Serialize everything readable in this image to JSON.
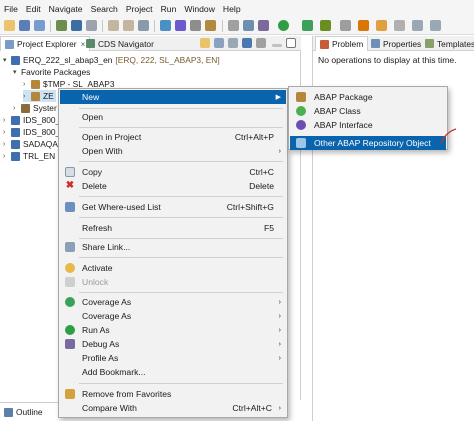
{
  "menubar": [
    "File",
    "Edit",
    "Navigate",
    "Search",
    "Project",
    "Run",
    "Window",
    "Help"
  ],
  "left_tabs": {
    "project_explorer": "Project Explorer",
    "cds_navigator": "CDS Navigator"
  },
  "tree": {
    "root_name": "ERQ_222_sl_abap3_en",
    "root_decor": "[ERQ, 222, SL_ABAP3, EN]",
    "favorite_packages": "Favorite Packages",
    "tmp_package": "$TMP - SL_ABAP3",
    "ze_item": "ZE",
    "system_item": "Syster",
    "ids1": "IDS_800_",
    "ids2": "IDS_800_",
    "sadaq": "SADAQA",
    "trl": "TRL_EN ["
  },
  "right_tabs": {
    "problems": "Problem",
    "properties": "Properties",
    "templates": "Templates"
  },
  "right_message": "No operations to display at this time.",
  "outline_tab": "Outline",
  "context_menu": {
    "new": "New",
    "open": "Open",
    "open_in_project": "Open in Project",
    "open_in_project_shortcut": "Ctrl+Alt+P",
    "open_with": "Open With",
    "copy": "Copy",
    "copy_shortcut": "Ctrl+C",
    "delete": "Delete",
    "delete_shortcut": "Delete",
    "where_used": "Get Where-used List",
    "where_used_shortcut": "Ctrl+Shift+G",
    "refresh": "Refresh",
    "refresh_shortcut": "F5",
    "share_link": "Share Link...",
    "activate": "Activate",
    "unlock": "Unlock",
    "coverage_as_1": "Coverage As",
    "coverage_as_2": "Coverage As",
    "run_as": "Run As",
    "debug_as": "Debug As",
    "profile_as": "Profile As",
    "add_bookmark": "Add Bookmark...",
    "remove_favorites": "Remove from Favorites",
    "compare_with": "Compare With",
    "compare_with_shortcut": "Ctrl+Alt+C"
  },
  "new_submenu": {
    "abap_package": "ABAP Package",
    "abap_class": "ABAP Class",
    "abap_interface": "ABAP Interface",
    "other": "Other ABAP Repository Object"
  },
  "colors": {
    "highlight": "#0a64ad",
    "menu_bg": "#f2f2f2",
    "annotation_red": "#c0392b"
  },
  "icons": [
    "new-icon",
    "copy-icon",
    "delete-icon",
    "where-used-icon",
    "refresh-icon",
    "share-link-icon",
    "activate-icon",
    "unlock-icon",
    "coverage-icon",
    "run-icon",
    "debug-icon",
    "remove-favorite-icon",
    "package-icon",
    "class-icon",
    "interface-icon",
    "repository-object-icon"
  ]
}
